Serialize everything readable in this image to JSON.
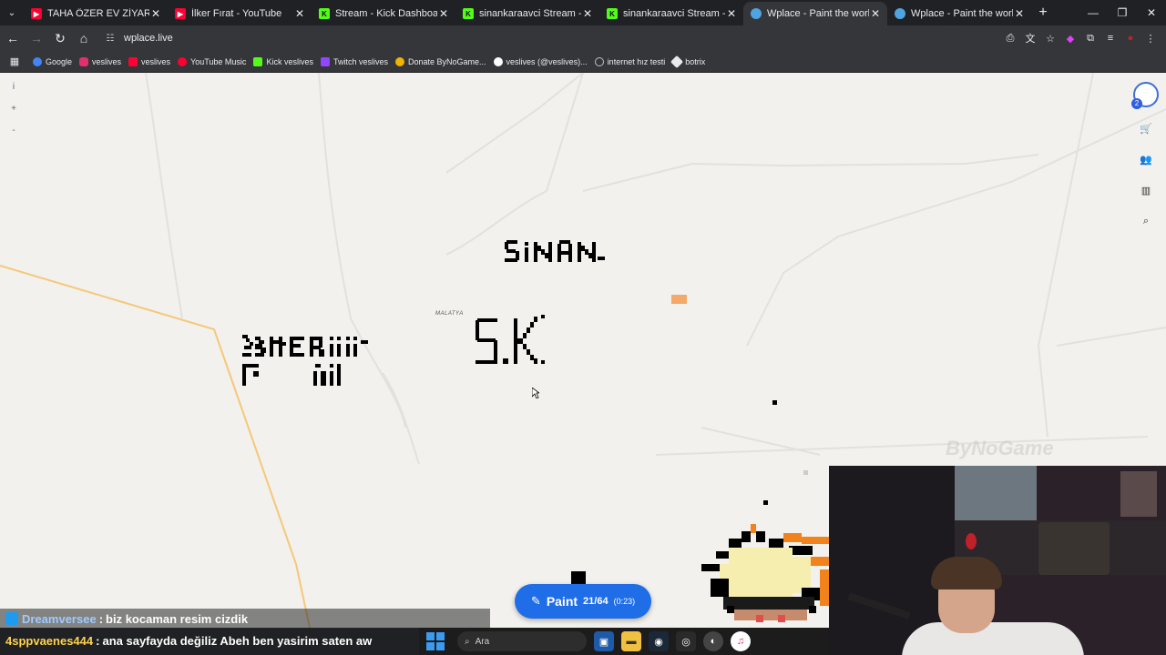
{
  "tabs": [
    {
      "title": "TAHA ÖZER EV ZİYARETİ - YouTube",
      "favicon": "youtube-icon",
      "color": "#ff0033",
      "active": false
    },
    {
      "title": "İlker Fırat - YouTube",
      "favicon": "youtube-icon",
      "color": "#ff0033",
      "active": false
    },
    {
      "title": "Stream - Kick Dashboard",
      "favicon": "kick-icon",
      "color": "#53fc18",
      "active": false
    },
    {
      "title": "sinankaraavci Stream - Watch Live",
      "favicon": "kick-icon",
      "color": "#53fc18",
      "active": false
    },
    {
      "title": "sinankaraavci Stream - Watch Live",
      "favicon": "kick-icon",
      "color": "#53fc18",
      "active": false
    },
    {
      "title": "Wplace - Paint the world",
      "favicon": "globe-icon",
      "color": "#4fa3e0",
      "active": true
    },
    {
      "title": "Wplace - Paint the world",
      "favicon": "globe-icon",
      "color": "#4fa3e0",
      "active": false
    }
  ],
  "address": {
    "url": "wplace.live"
  },
  "bookmarks": [
    {
      "label": "Google",
      "color": "#4285f4"
    },
    {
      "label": "veslives",
      "color": "#e1306c"
    },
    {
      "label": "veslives",
      "color": "#ff0033"
    },
    {
      "label": "YouTube Music",
      "color": "#ff0033"
    },
    {
      "label": "Kick veslives",
      "color": "#53fc18"
    },
    {
      "label": "Twitch veslives",
      "color": "#9146ff"
    },
    {
      "label": "Donate ByNoGame...",
      "color": "#f0b400"
    },
    {
      "label": "veslives (@veslives)...",
      "color": "#ffffff"
    },
    {
      "label": "internet hız testi",
      "color": "#bdc1c6"
    },
    {
      "label": "botrix",
      "color": "#e8eaed"
    }
  ],
  "map": {
    "city_label": "MALATYA",
    "zoom_in": "+",
    "zoom_out": "-",
    "info": "i"
  },
  "paint_button": {
    "label": "Paint",
    "count": "21/64",
    "timer": "(0:23)"
  },
  "user": {
    "level": "2"
  },
  "watermark": "ByNoGame",
  "chat": [
    {
      "user": "Dreamversee",
      "message": "biz kocaman resim cizdik"
    },
    {
      "user": "4sppvaenes444",
      "message": "ana sayfayda değiliz Abeh ben yasirim saten aw"
    }
  ],
  "taskbar": {
    "search_placeholder": "Ara"
  },
  "colors": {
    "accent": "#1f6ee8",
    "map_bg": "#f2f1ee",
    "road": "#f5c878"
  }
}
